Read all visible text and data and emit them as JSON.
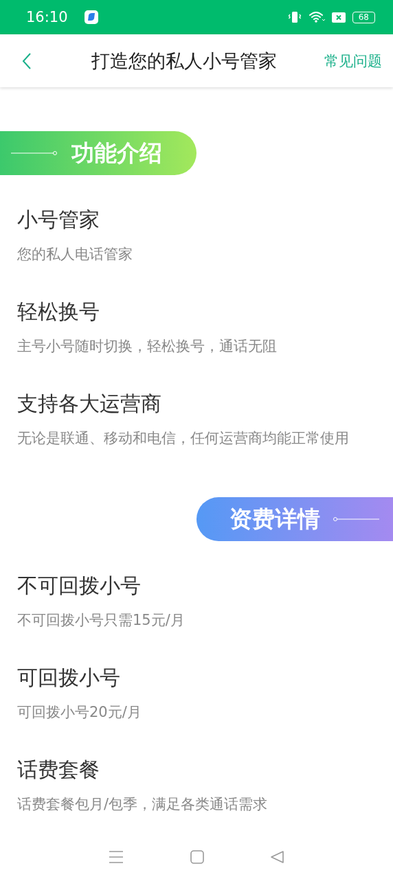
{
  "status_bar": {
    "time": "16:10",
    "battery": "68"
  },
  "header": {
    "title": "打造您的私人小号管家",
    "action": "常见问题"
  },
  "sections": [
    {
      "banner": {
        "text": "功能介绍",
        "kind": "left",
        "color": "#3cc96c"
      },
      "items": [
        {
          "title": "小号管家",
          "subtitle": "您的私人电话管家"
        },
        {
          "title": "轻松换号",
          "subtitle": "主号小号随时切换，轻松换号，通话无阻"
        },
        {
          "title": "支持各大运营商",
          "subtitle": "无论是联通、移动和电信，任何运营商均能正常使用"
        }
      ]
    },
    {
      "banner": {
        "text": "资费详情",
        "kind": "right",
        "color": "#5599f5"
      },
      "items": [
        {
          "title": "不可回拨小号",
          "subtitle": "不可回拨小号只需15元/月"
        },
        {
          "title": "可回拨小号",
          "subtitle": "可回拨小号20元/月"
        },
        {
          "title": "话费套餐",
          "subtitle": "话费套餐包月/包季，满足各类通话需求"
        }
      ]
    }
  ]
}
